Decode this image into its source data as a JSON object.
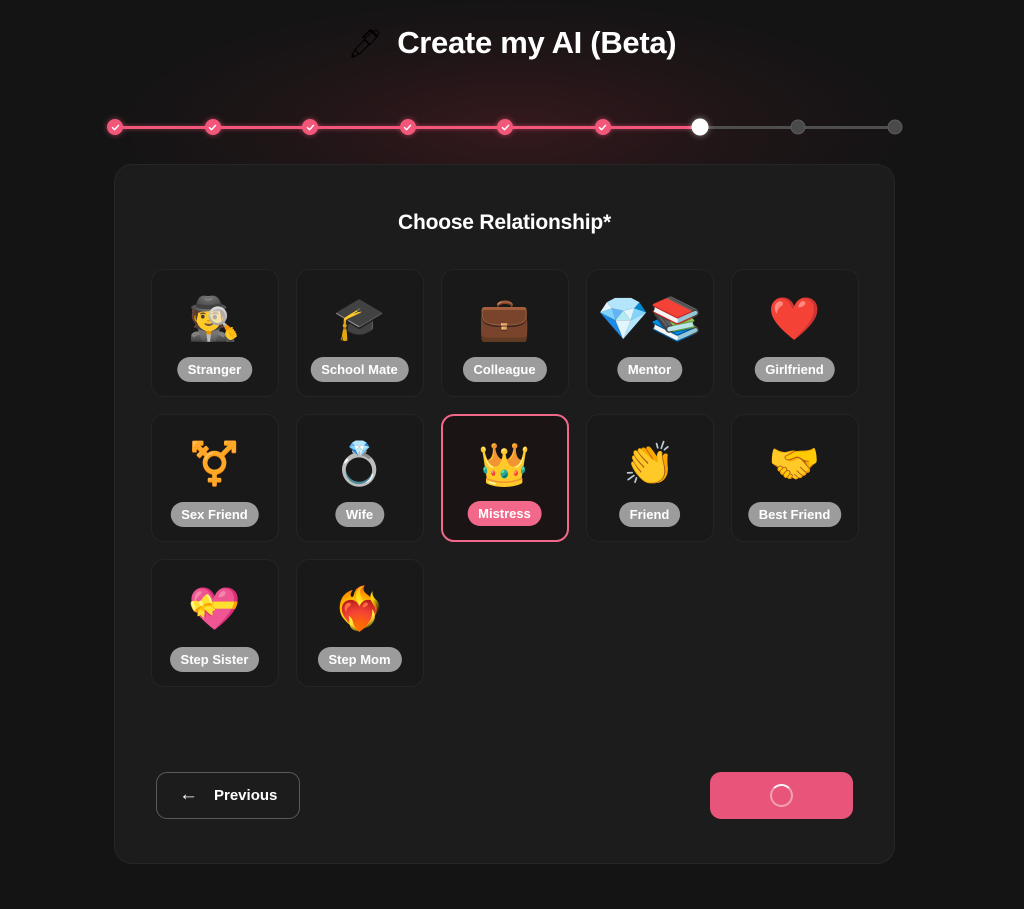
{
  "header": {
    "icon": "pencil-add-icon",
    "icon_glyph": "🖊",
    "title": "Create my AI (Beta)"
  },
  "progress": {
    "total_steps": 9,
    "current_step": 7,
    "completed_steps": 6,
    "done_color": "#f2577a",
    "current_color": "#ffffff",
    "todo_color": "#4a4a4a",
    "check_glyph": "✓",
    "steps": [
      {
        "state": "done"
      },
      {
        "state": "done"
      },
      {
        "state": "done"
      },
      {
        "state": "done"
      },
      {
        "state": "done"
      },
      {
        "state": "done"
      },
      {
        "state": "current"
      },
      {
        "state": "todo"
      },
      {
        "state": "todo"
      }
    ]
  },
  "panel": {
    "heading": "Choose Relationship*"
  },
  "relationships": [
    {
      "label": "Stranger",
      "emoji": "🕵️",
      "icon_name": "detective-icon",
      "selected": false
    },
    {
      "label": "School Mate",
      "emoji": "🎓",
      "icon_name": "graduation-cap-icon",
      "selected": false
    },
    {
      "label": "Colleague",
      "emoji": "💼",
      "icon_name": "briefcase-icon",
      "selected": false
    },
    {
      "label": "Mentor",
      "emoji": "💎📚",
      "icon_name": "gem-books-icon",
      "selected": false
    },
    {
      "label": "Girlfriend",
      "emoji": "❤️",
      "icon_name": "red-heart-icon",
      "selected": false
    },
    {
      "label": "Sex Friend",
      "emoji": "⚧️",
      "icon_name": "gender-symbols-icon",
      "selected": false
    },
    {
      "label": "Wife",
      "emoji": "💍",
      "icon_name": "rings-icon",
      "selected": false
    },
    {
      "label": "Mistress",
      "emoji": "👑",
      "icon_name": "crown-heart-icon",
      "selected": true
    },
    {
      "label": "Friend",
      "emoji": "👏",
      "icon_name": "clapping-hands-icon",
      "selected": false
    },
    {
      "label": "Best Friend",
      "emoji": "🤝",
      "icon_name": "handshake-icon",
      "selected": false
    },
    {
      "label": "Step Sister",
      "emoji": "💝",
      "icon_name": "heart-ribbon-icon",
      "selected": false
    },
    {
      "label": "Step Mom",
      "emoji": "❤️‍🔥",
      "icon_name": "heart-on-fire-icon",
      "selected": false
    }
  ],
  "footer": {
    "previous_label": "Previous",
    "previous_arrow": "←",
    "next_label": "",
    "next_state": "loading",
    "next_icon_name": "loading-spinner-icon",
    "next_color": "#e8547a"
  }
}
